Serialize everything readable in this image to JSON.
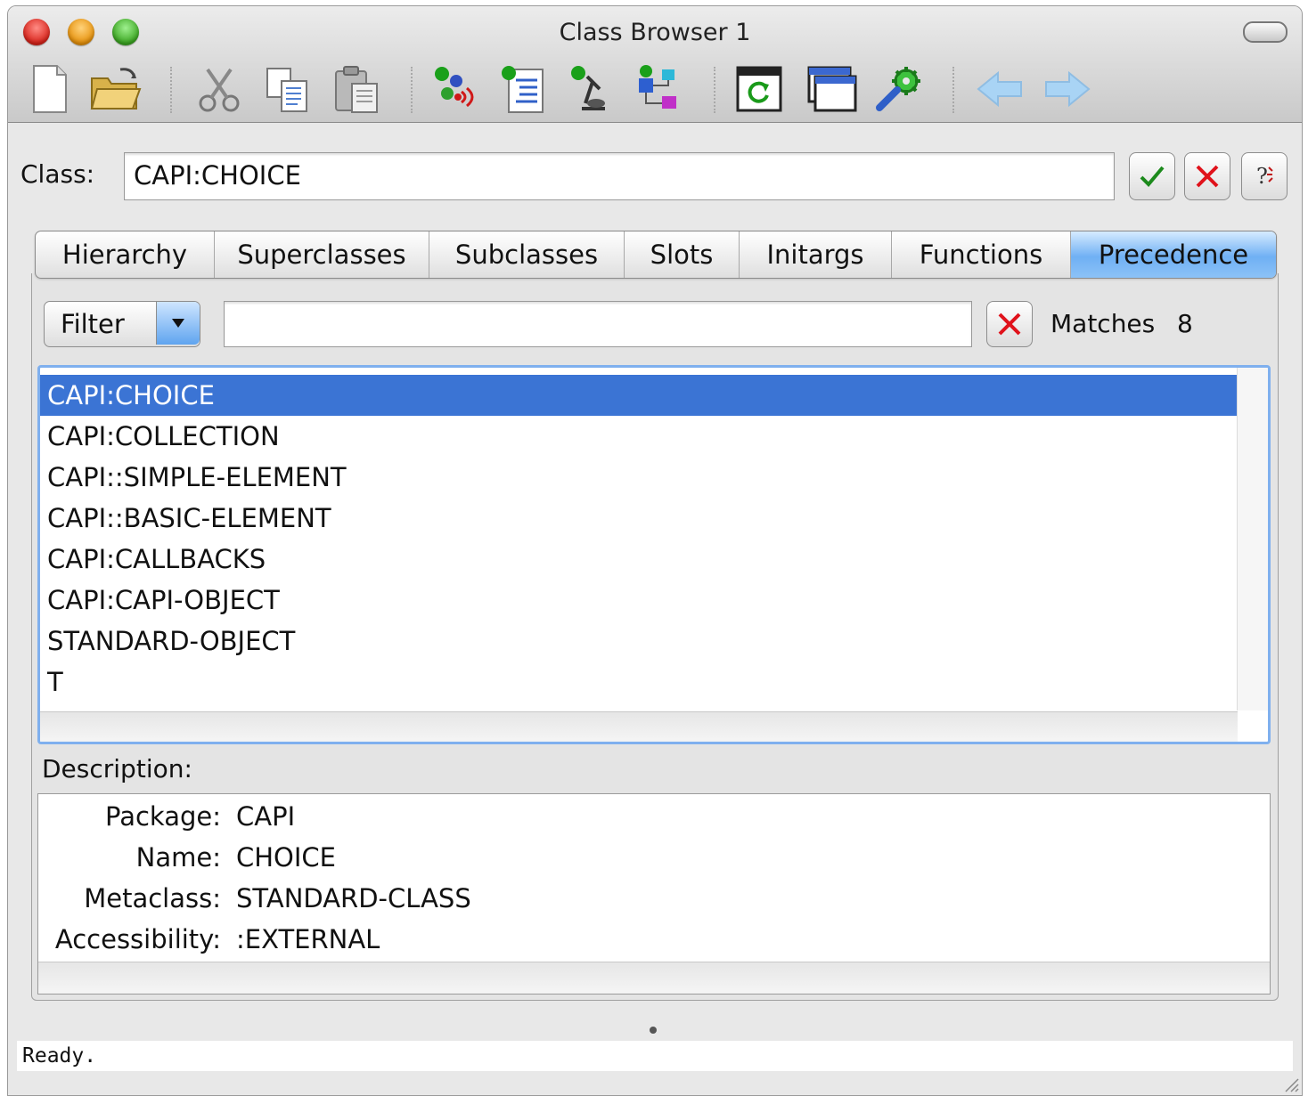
{
  "window": {
    "title": "Class Browser 1"
  },
  "toolbar": {
    "buttons": [
      {
        "name": "new-icon"
      },
      {
        "name": "open-folder-icon"
      },
      {
        "name": "cut-icon"
      },
      {
        "name": "copy-icon"
      },
      {
        "name": "paste-icon"
      },
      {
        "name": "inspect-icon"
      },
      {
        "name": "list-icon"
      },
      {
        "name": "browse-icon"
      },
      {
        "name": "graph-icon"
      },
      {
        "name": "refresh-icon"
      },
      {
        "name": "window-icon"
      },
      {
        "name": "settings-icon"
      },
      {
        "name": "back-arrow-icon"
      },
      {
        "name": "forward-arrow-icon"
      }
    ]
  },
  "class_field": {
    "label": "Class:",
    "value": "CAPI:CHOICE"
  },
  "tabs": [
    {
      "label": "Hierarchy"
    },
    {
      "label": "Superclasses"
    },
    {
      "label": "Subclasses"
    },
    {
      "label": "Slots"
    },
    {
      "label": "Initargs"
    },
    {
      "label": "Functions"
    },
    {
      "label": "Precedence",
      "active": true
    }
  ],
  "filter": {
    "label": "Filter",
    "value": "",
    "matches_label": "Matches",
    "matches_count": "8"
  },
  "precedence_list": [
    "CAPI:CHOICE",
    "CAPI:COLLECTION",
    "CAPI::SIMPLE-ELEMENT",
    "CAPI::BASIC-ELEMENT",
    "CAPI:CALLBACKS",
    "CAPI:CAPI-OBJECT",
    "STANDARD-OBJECT",
    "T"
  ],
  "selected_index": 0,
  "description": {
    "label": "Description:",
    "rows": [
      {
        "key": "Package:",
        "value": "CAPI"
      },
      {
        "key": "Name:",
        "value": "CHOICE"
      },
      {
        "key": "Metaclass:",
        "value": "STANDARD-CLASS"
      },
      {
        "key": "Accessibility:",
        "value": ":EXTERNAL"
      }
    ]
  },
  "status": {
    "text": "Ready."
  },
  "colors": {
    "selection": "#3b74d4",
    "active_tab": "#6fb0f4",
    "focus_ring": "#7fb0ee",
    "cancel_red": "#e0121b",
    "ok_green": "#1c8a1c"
  }
}
